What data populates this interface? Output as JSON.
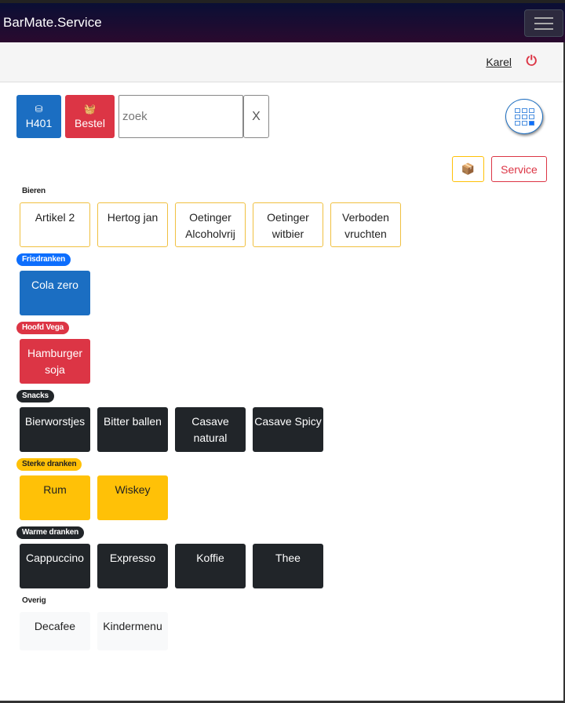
{
  "app": {
    "title": "BarMate.Service"
  },
  "user": {
    "name": "Karel"
  },
  "toolbar": {
    "table_label": "H401",
    "order_label": "Bestel",
    "search_placeholder": "zoek",
    "search_value": "",
    "clear_label": "X",
    "service_label": "Service"
  },
  "colors": {
    "primary": "#1b6ec2",
    "danger": "#dc3545",
    "warning": "#ffc107",
    "dark": "#212529"
  },
  "groups": [
    {
      "label": "Bieren",
      "items": [
        "Artikel 2",
        "Hertog jan",
        "Oetinger Alcoholvrij",
        "Oetinger witbier",
        "Verboden vruchten"
      ]
    },
    {
      "label": "Frisdranken",
      "items": [
        "Cola zero"
      ]
    },
    {
      "label": "Hoofd Vega",
      "items": [
        "Hamburger soja"
      ]
    },
    {
      "label": "Snacks",
      "items": [
        "Bierworstjes",
        "Bitter ballen",
        "Casave natural",
        "Casave Spicy"
      ]
    },
    {
      "label": "Sterke dranken",
      "items": [
        "Rum",
        "Wiskey"
      ]
    },
    {
      "label": "Warme dranken",
      "items": [
        "Cappuccino",
        "Expresso",
        "Koffie",
        "Thee"
      ]
    },
    {
      "label": "Overig",
      "items": [
        "Decafee",
        "Kindermenu"
      ]
    }
  ]
}
